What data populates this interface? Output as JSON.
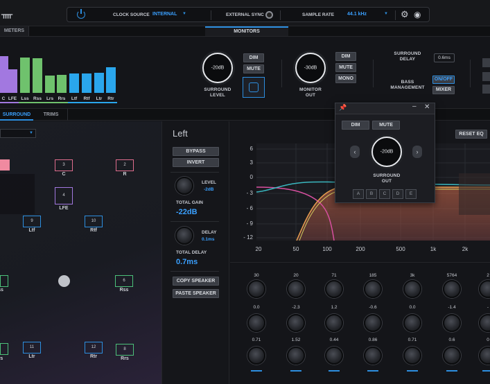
{
  "topbar": {
    "clock_source_label": "CLOCK SOURCE",
    "clock_source_value": "INTERNAL",
    "external_sync_label": "EXTERNAL SYNC",
    "sample_rate_label": "SAMPLE RATE",
    "sample_rate_value": "44.1 kHz"
  },
  "tabs_top": {
    "meters": "METERS",
    "monitors": "MONITORS"
  },
  "meters": {
    "channels": [
      "C",
      "LFE",
      "Lss",
      "Rss",
      "Lrs",
      "Rrs",
      "Ltf",
      "Rtf",
      "Ltr",
      "Rtr"
    ],
    "levels": [
      0.85,
      0.55,
      0.82,
      0.8,
      0.4,
      0.42,
      0.45,
      0.45,
      0.47,
      0.6
    ],
    "colors": [
      "#a278e0",
      "#a278e0",
      "#6fc26d",
      "#6fc26d",
      "#6fc26d",
      "#6fc26d",
      "#2aa6ec",
      "#2aa6ec",
      "#2aa6ec",
      "#2aa6ec"
    ]
  },
  "monitors": {
    "surround_level_value": "-20dB",
    "surround_level_label": "SURROUND\nLEVEL",
    "dim": "DIM",
    "mute": "MUTE",
    "monitor_out_value": "-30dB",
    "monitor_out_label": "MONITOR\nOUT",
    "dim2": "DIM",
    "mute2": "MUTE",
    "mono": "MONO",
    "surround_delay_label": "SURROUND\nDELAY",
    "surround_delay_value": "0.6ms",
    "bass_management_label": "BASS\nMANAGEMENT",
    "bass_management_value": "ON/OFF",
    "mixer": "MIXER"
  },
  "tabs_mid": {
    "surround": "SURROUND",
    "trims": "TRIMS"
  },
  "speakers": [
    {
      "n": "3",
      "name": "C"
    },
    {
      "n": "2",
      "name": "R"
    },
    {
      "n": "4",
      "name": "LFE"
    },
    {
      "n": "9",
      "name": "Ltf"
    },
    {
      "n": "10",
      "name": "Rtf"
    },
    {
      "n": "6",
      "name": "Rss"
    },
    {
      "n": "11",
      "name": "Ltr"
    },
    {
      "n": "12",
      "name": "Rtr"
    },
    {
      "n": "8",
      "name": "Rrs"
    },
    {
      "n": "",
      "name": "ss"
    },
    {
      "n": "",
      "name": "rs"
    }
  ],
  "channel_panel": {
    "title": "Left",
    "bypass": "BYPASS",
    "invert": "INVERT",
    "level_label": "LEVEL",
    "level_value": "-2dB",
    "total_gain_label": "TOTAL GAIN",
    "total_gain_value": "-22dB",
    "delay_label": "DELAY",
    "delay_value": "0.1ms",
    "total_delay_label": "TOTAL DELAY",
    "total_delay_value": "0.7ms",
    "copy_speaker": "COPY SPEAKER",
    "paste_speaker": "PASTE SPEAKER"
  },
  "eq": {
    "reset": "RESET EQ",
    "y_ticks": [
      "6",
      "3",
      "0",
      "- 3",
      "- 6",
      "- 9",
      "- 12"
    ],
    "x_ticks": [
      "20",
      "50",
      "100",
      "200",
      "500",
      "1k",
      "2k"
    ],
    "freq": [
      "30",
      "20",
      "71",
      "185",
      "3k",
      "5764",
      "2"
    ],
    "gain": [
      "0.0",
      "-2.3",
      "1.2",
      "-0.6",
      "0.0",
      "-1.4",
      "-"
    ],
    "q": [
      "0.71",
      "1.52",
      "0.44",
      "0.86",
      "0.71",
      "0.6",
      "0"
    ]
  },
  "popup": {
    "dim": "DIM",
    "mute": "MUTE",
    "knob_value": "-20dB",
    "label": "SURROUND\nOUT",
    "slots": [
      "A",
      "B",
      "C",
      "D",
      "E"
    ]
  }
}
